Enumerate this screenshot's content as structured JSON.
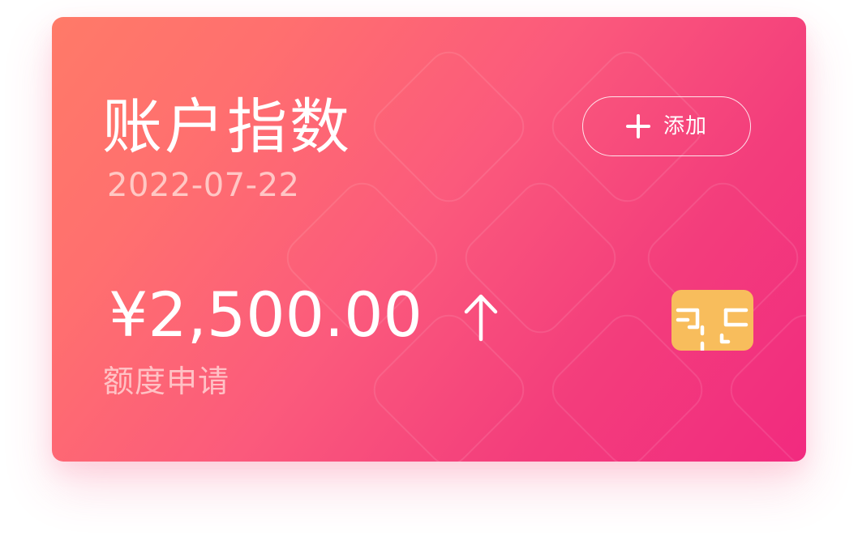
{
  "card": {
    "title": "账户指数",
    "date": "2022-07-22",
    "amount": "¥2,500.00",
    "subtitle": "额度申请",
    "add_button_label": "添加",
    "icons": {
      "add": "plus-icon",
      "trend": "arrow-up-icon",
      "chip": "card-chip-icon"
    },
    "colors": {
      "gradient_start": "#ff7a68",
      "gradient_end": "#f22a7f",
      "chip": "#f8bd5c",
      "text": "#ffffff"
    }
  }
}
